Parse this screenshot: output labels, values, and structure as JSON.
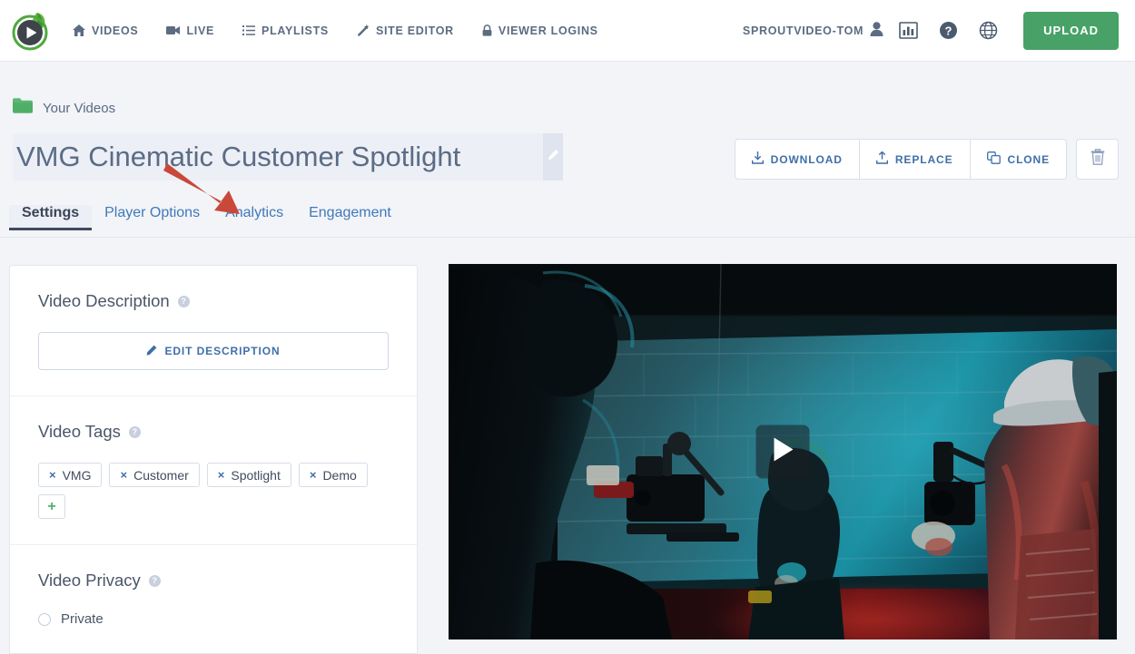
{
  "brand": {
    "logo_name": "sproutvideo-logo",
    "accent_green": "#48a267",
    "link_blue": "#3f6fa8",
    "text_slate": "#4a5668",
    "page_bg": "#f2f4f8"
  },
  "header": {
    "nav": [
      {
        "label": "Videos",
        "icon": "home-icon"
      },
      {
        "label": "Live",
        "icon": "video-camera-icon"
      },
      {
        "label": "Playlists",
        "icon": "list-icon"
      },
      {
        "label": "Site Editor",
        "icon": "magic-wand-icon"
      },
      {
        "label": "Viewer Logins",
        "icon": "lock-icon"
      }
    ],
    "account_label": "SPROUTVIDEO-TOM",
    "account_icon": "user-icon",
    "icons": [
      {
        "name": "analytics-bar-chart-icon"
      },
      {
        "name": "help-question-icon"
      },
      {
        "name": "globe-icon"
      }
    ],
    "upload_label": "Upload"
  },
  "breadcrumb": {
    "icon": "folder-icon",
    "label": "Your Videos"
  },
  "title": {
    "value": "VMG Cinematic Customer Spotlight",
    "edit_icon": "pencil-icon"
  },
  "actions": {
    "download_label": "Download",
    "download_icon": "download-arrow-icon",
    "replace_label": "Replace",
    "replace_icon": "upload-arrow-icon",
    "clone_label": "Clone",
    "clone_icon": "copy-icon",
    "delete_icon": "trash-icon"
  },
  "tabs": [
    {
      "label": "Settings",
      "active": true
    },
    {
      "label": "Player Options",
      "active": false
    },
    {
      "label": "Analytics",
      "active": false
    },
    {
      "label": "Engagement",
      "active": false
    }
  ],
  "panel": {
    "description": {
      "title": "Video Description",
      "help_icon": "help-question-icon",
      "edit_button_label": "Edit Description",
      "edit_button_icon": "pencil-icon"
    },
    "tags": {
      "title": "Video Tags",
      "help_icon": "help-question-icon",
      "items": [
        "VMG",
        "Customer",
        "Spotlight",
        "Demo"
      ],
      "remove_glyph": "×",
      "add_glyph": "+"
    },
    "privacy": {
      "title": "Video Privacy",
      "help_icon": "help-question-icon",
      "options": [
        {
          "label": "Private",
          "selected": false
        }
      ]
    }
  },
  "video": {
    "play_icon": "play-triangle-icon",
    "description": "Dark behind-the-scenes film set still with teal and red cinematic lighting"
  },
  "annotation": {
    "arrow_color": "#c9483a",
    "points_to": "Analytics"
  }
}
